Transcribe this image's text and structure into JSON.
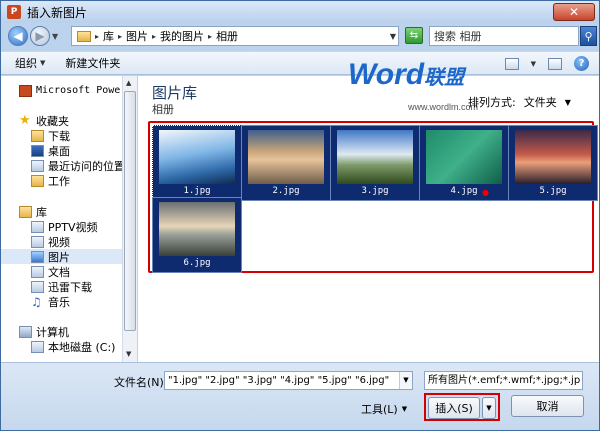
{
  "window": {
    "title": "插入新图片",
    "app_icon": "P",
    "close_label": "✕"
  },
  "nav": {
    "breadcrumbs": [
      "库",
      "图片",
      "我的图片",
      "相册"
    ],
    "search_placeholder": "搜索 相册"
  },
  "toolbar": {
    "organize": "组织",
    "new_folder": "新建文件夹"
  },
  "sidebar": {
    "items": [
      {
        "label": "Microsoft PowerPo",
        "icon": "powerpoint-icon"
      },
      {
        "label": "收藏夹",
        "icon": "star-icon"
      },
      {
        "label": "下载",
        "icon": "download-folder-icon"
      },
      {
        "label": "桌面",
        "icon": "desktop-icon"
      },
      {
        "label": "最近访问的位置",
        "icon": "recent-places-icon"
      },
      {
        "label": "工作",
        "icon": "folder-icon"
      },
      {
        "label": "库",
        "icon": "library-icon"
      },
      {
        "label": "PPTV视频",
        "icon": "video-library-icon"
      },
      {
        "label": "视频",
        "icon": "video-library-icon"
      },
      {
        "label": "图片",
        "icon": "pictures-library-icon"
      },
      {
        "label": "文档",
        "icon": "documents-library-icon"
      },
      {
        "label": "迅雷下载",
        "icon": "download-library-icon"
      },
      {
        "label": "音乐",
        "icon": "music-icon"
      },
      {
        "label": "计算机",
        "icon": "computer-icon"
      },
      {
        "label": "本地磁盘 (C:)",
        "icon": "drive-icon"
      }
    ]
  },
  "main": {
    "library_title": "图片库",
    "library_subtitle": "相册",
    "arrange_label": "排列方式:",
    "arrange_value": "文件夹",
    "watermark": {
      "brand": "Word",
      "brand_cn": "联盟",
      "url": "www.wordlm.com"
    },
    "files": [
      "1.jpg",
      "2.jpg",
      "3.jpg",
      "4.jpg",
      "5.jpg",
      "6.jpg"
    ]
  },
  "bottom": {
    "filename_label": "文件名(N):",
    "filename_value": "\"1.jpg\" \"2.jpg\" \"3.jpg\" \"4.jpg\" \"5.jpg\" \"6.jpg\"",
    "filetype_value": "所有图片(*.emf;*.wmf;*.jpg;*.jp",
    "tools_label": "工具(L)",
    "insert_label": "插入(S)",
    "cancel_label": "取消"
  },
  "colors": {
    "highlight_box": "#d40000",
    "thumb_bg": "#0d2b6e",
    "accent": "#1d67c8"
  }
}
